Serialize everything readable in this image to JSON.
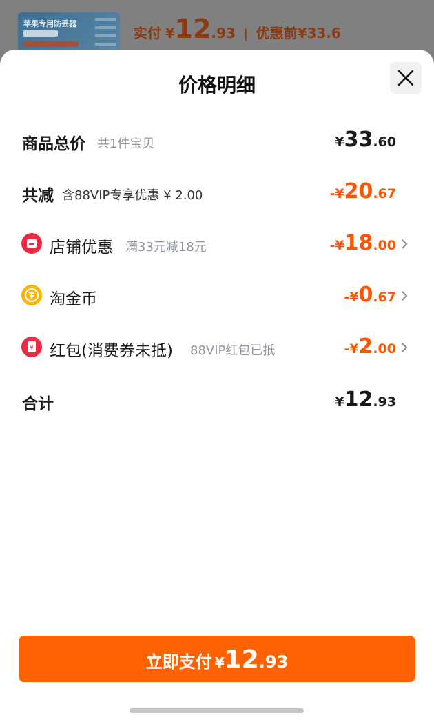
{
  "background": {
    "product_title": "苹果专用防丢器",
    "paid_label": "实付",
    "paid_yen": "¥",
    "paid_int": "12",
    "paid_dec": ".93",
    "separator": "|",
    "before_label": "优惠前",
    "before_price": "¥33.6"
  },
  "sheet": {
    "title": "价格明细",
    "close_icon": "close-icon"
  },
  "rows": {
    "total": {
      "label": "商品总价",
      "sub": "共1件宝贝",
      "sign": "",
      "yen": "¥",
      "int": "33",
      "dec": ".60"
    },
    "reduce": {
      "label": "共减",
      "sub": "含88VIP专享优惠 ¥ 2.00",
      "sign": "-",
      "yen": "¥",
      "int": "20",
      "dec": ".67"
    },
    "shop": {
      "label": "店铺优惠",
      "sub": "满33元减18元",
      "sign": "-",
      "yen": "¥",
      "int": "18",
      "dec": ".00",
      "icon": "store-icon"
    },
    "coin": {
      "label": "淘金币",
      "sub": "",
      "sign": "-",
      "yen": "¥",
      "int": "0",
      "dec": ".67",
      "icon": "taojinbi-coin-icon"
    },
    "redpacket": {
      "label": "红包(消费券未抵)",
      "sub": "88VIP红包已抵",
      "sign": "-",
      "yen": "¥",
      "int": "2",
      "dec": ".00",
      "icon": "red-packet-icon"
    },
    "sum": {
      "label": "合计",
      "yen": "¥",
      "int": "12",
      "dec": ".93"
    }
  },
  "pay_button": {
    "label": "立即支付",
    "yen": "¥",
    "int": "12",
    "dec": ".93"
  },
  "colors": {
    "accent": "#ff6200",
    "discount": "#ff5500",
    "muted": "#8d929c"
  }
}
